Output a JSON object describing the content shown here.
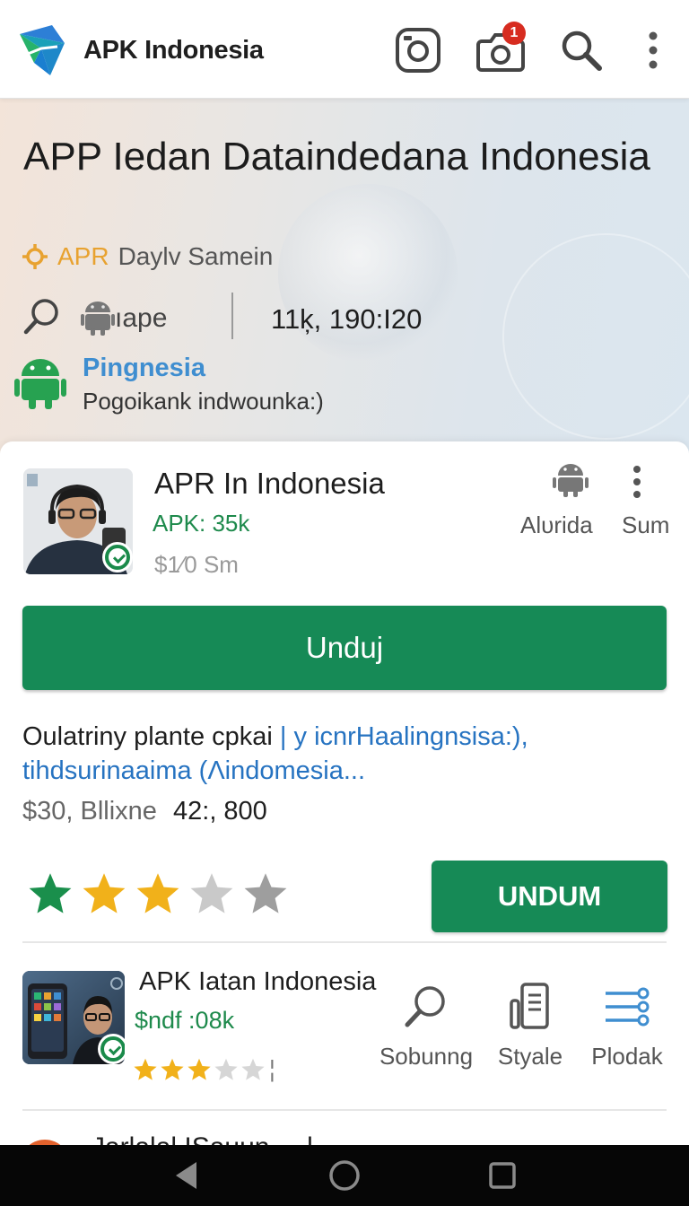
{
  "app_bar": {
    "title": "APK Indonesia",
    "notification_count": "1",
    "icons": [
      "logo-icon",
      "instagram-icon",
      "camera-icon",
      "search-icon",
      "more-vert-icon"
    ]
  },
  "hero": {
    "title": "APP Iedan Dataindedana Indonesia",
    "subtitle_accent": "APR",
    "subtitle_rest": "Daylv Samein",
    "platform_label": "ıape",
    "stat": "11ķ, 190:I20",
    "promo_title": "Pingnesia",
    "promo_text": "Pogoikank indwounka:)"
  },
  "item1": {
    "name": "APR In Indonesia",
    "size": "APK: 35k",
    "price": "$1⁄0 Sm",
    "os_label": "Alυrida",
    "sum_label": "Sum"
  },
  "download_button": "Unduj",
  "description": {
    "line1_dark": "Oulatriny plante cpkai",
    "line1_blue": " | y icnrHaalingnsisa:),",
    "line2": "tihdsurinaaima (Λindomesia..."
  },
  "meta": {
    "left": "$30, Bllixne",
    "right": "42:, 800"
  },
  "rating": {
    "value": 3,
    "max": 5,
    "colors": [
      "#1a8f4c",
      "#f1b11a",
      "#f1b11a",
      "#c9c9c9",
      "#9e9e9e"
    ]
  },
  "secondary_button": "UNDUM",
  "item2": {
    "name": "APK Iatan Indonesia",
    "size": "$ndf :08k",
    "rating": 3,
    "rating_tail": "¦",
    "actions": [
      {
        "label": "Sobunng",
        "icon": "search-icon"
      },
      {
        "label": "Styale",
        "icon": "phone-device-icon"
      },
      {
        "label": "Plodak",
        "icon": "sliders-icon"
      }
    ]
  },
  "item3": {
    "text": "Jarlalal ISauun ... l"
  },
  "nav": {
    "buttons": [
      "back-icon",
      "home-icon",
      "recents-icon"
    ]
  },
  "colors": {
    "brand_green": "#168a56",
    "accent_orange": "#e8a230",
    "link_blue": "#2673c1",
    "badge_red": "#d72c20"
  }
}
